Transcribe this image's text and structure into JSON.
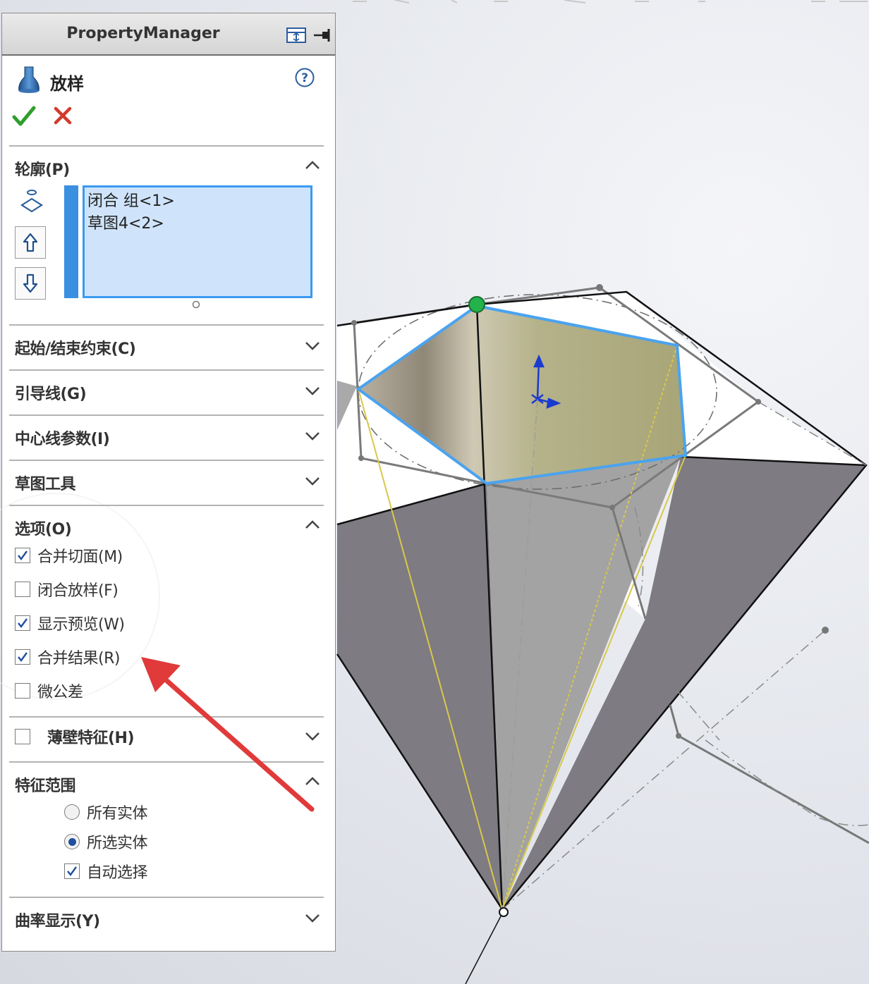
{
  "panel": {
    "title": "PropertyManager",
    "feature_name": "放样"
  },
  "sections": {
    "profile": {
      "title": "轮廓(P)",
      "items": [
        "闭合 组<1>",
        "草图4<2>"
      ]
    },
    "start_end": {
      "title": "起始/结束约束(C)"
    },
    "guide": {
      "title": "引导线(G)"
    },
    "centerline": {
      "title": "中心线参数(I)"
    },
    "sketch_tools": {
      "title": "草图工具"
    },
    "options": {
      "title": "选项(O)",
      "items": [
        {
          "label": "合并切面(M)",
          "checked": true
        },
        {
          "label": "闭合放样(F)",
          "checked": false
        },
        {
          "label": "显示预览(W)",
          "checked": true
        },
        {
          "label": "合并结果(R)",
          "checked": true
        },
        {
          "label": "微公差",
          "checked": false
        }
      ]
    },
    "thin": {
      "title": "薄壁特征(H)",
      "checked": false
    },
    "scope": {
      "title": "特征范围",
      "radios": [
        {
          "label": "所有实体",
          "selected": false
        },
        {
          "label": "所选实体",
          "selected": true
        }
      ],
      "auto_select": {
        "label": "自动选择",
        "checked": true
      }
    },
    "curvature": {
      "title": "曲率显示(Y)"
    }
  },
  "colors": {
    "accent_blue": "#3b9af0",
    "ok_green": "#2e9e2e",
    "cancel_red": "#d23a2a",
    "annotation_arrow": "#e03a3a"
  }
}
